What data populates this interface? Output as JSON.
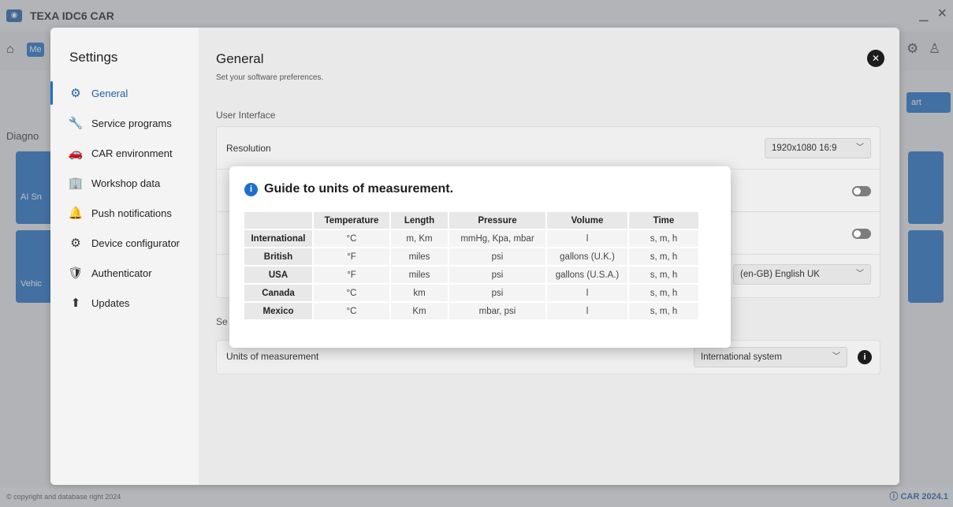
{
  "app": {
    "title": "TEXA IDC6 CAR",
    "minimize": "_",
    "close": "×"
  },
  "navbar": {
    "me_label": "Me"
  },
  "background": {
    "start_label": "art",
    "diag_label": "Diagno",
    "tile1_label": "AI Sn",
    "tile2_label": "Vehic",
    "copyright": "© copyright and database right 2024",
    "version": "CAR 2024.1"
  },
  "settings": {
    "title": "Settings",
    "menu": [
      {
        "label": "General",
        "icon": "gear-icon",
        "glyph": "⚙"
      },
      {
        "label": "Service programs",
        "icon": "wrench-icon",
        "glyph": "🔧"
      },
      {
        "label": "CAR environment",
        "icon": "car-icon",
        "glyph": "🚗"
      },
      {
        "label": "Workshop data",
        "icon": "building-icon",
        "glyph": "🏢"
      },
      {
        "label": "Push notifications",
        "icon": "notification-icon",
        "glyph": "🔔"
      },
      {
        "label": "Device configurator",
        "icon": "device-icon",
        "glyph": "⚙"
      },
      {
        "label": "Authenticator",
        "icon": "shield-icon",
        "glyph": "🛡"
      },
      {
        "label": "Updates",
        "icon": "updates-icon",
        "glyph": "⬆"
      }
    ],
    "main": {
      "title": "General",
      "subtitle": "Set your software preferences.",
      "ui_section": "User Interface",
      "resolution_label": "Resolution",
      "resolution_value": "1920x1080 16:9",
      "language_value": "(en-GB) English UK",
      "sec_section": "Se",
      "units_label": "Units of measurement",
      "units_value": "International system"
    }
  },
  "guide": {
    "title": "Guide to units of measurement.",
    "headers": [
      "",
      "Temperature",
      "Length",
      "Pressure",
      "Volume",
      "Time"
    ],
    "rows": [
      {
        "system": "International",
        "temperature": "°C",
        "length": "m, Km",
        "pressure": "mmHg, Kpa, mbar",
        "volume": "l",
        "time": "s, m, h"
      },
      {
        "system": "British",
        "temperature": "°F",
        "length": "miles",
        "pressure": "psi",
        "volume": "gallons (U.K.)",
        "time": "s, m, h"
      },
      {
        "system": "USA",
        "temperature": "°F",
        "length": "miles",
        "pressure": "psi",
        "volume": "gallons (U.S.A.)",
        "time": "s, m, h"
      },
      {
        "system": "Canada",
        "temperature": "°C",
        "length": "km",
        "pressure": "psi",
        "volume": "l",
        "time": "s, m, h"
      },
      {
        "system": "Mexico",
        "temperature": "°C",
        "length": "Km",
        "pressure": "mbar, psi",
        "volume": "l",
        "time": "s, m, h"
      }
    ]
  }
}
